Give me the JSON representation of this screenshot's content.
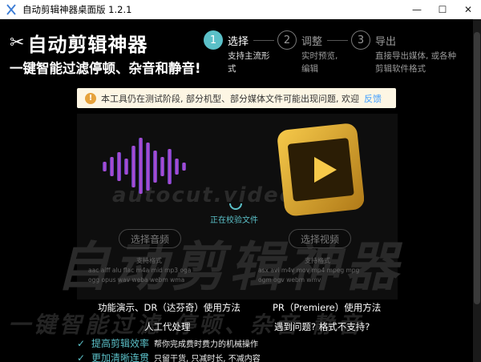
{
  "window": {
    "title": "自动剪辑神器桌面版 1.2.1",
    "minimize": "—",
    "maximize": "☐",
    "close": "✕"
  },
  "watermark": {
    "url": "autocut.video",
    "big": "自动剪辑神器",
    "line": "一键智能过滤  停顿、杂音  静音"
  },
  "brand": {
    "name": "自动剪辑神器",
    "slogan": "一键智能过滤停顿、杂音和静音!"
  },
  "steps": [
    {
      "number": "1",
      "label": "选择",
      "desc1": "支持主流形",
      "desc2": "式",
      "active": true
    },
    {
      "number": "2",
      "label": "调整",
      "desc1": "实时预览,",
      "desc2": "编辑",
      "active": false
    },
    {
      "number": "3",
      "label": "导出",
      "desc1": "直接导出媒体, 或各种",
      "desc2": "剪辑软件格式",
      "active": false
    }
  ],
  "notice": {
    "text": "本工具仍在测试阶段, 部分机型、部分媒体文件可能出现问题, 欢迎",
    "link": "反馈"
  },
  "loading": {
    "text": "正在校验文件"
  },
  "audio": {
    "button": "选择音频",
    "fmt_title": "支持格式",
    "formats_line1": "aac aiff alu flac m4a mid mp3 oga",
    "formats_line2": "ogg opus wav weba webm wma"
  },
  "video": {
    "button": "选择视频",
    "fmt_title": "支持格式",
    "formats_line1": "asx avi m4v mov mp4 mpeg mpg",
    "formats_line2": "ogm ogv webm wmv"
  },
  "links": {
    "dr": "功能演示、DR（达芬奇）使用方法",
    "pr": "PR（Premiere）使用方法",
    "manual": "人工代处理",
    "problem": "遇到问题? 格式不支持?"
  },
  "features": [
    {
      "title": "提高剪辑效率",
      "desc": "帮你完成费时费力的机械操作"
    },
    {
      "title": "更加清晰连贯",
      "desc": "只留干货, 只减时长, 不减内容"
    }
  ],
  "colors": {
    "accent": "#5bc0c8",
    "background": "#000000",
    "notice_bg": "#fdf6e4",
    "link": "#409eff"
  }
}
